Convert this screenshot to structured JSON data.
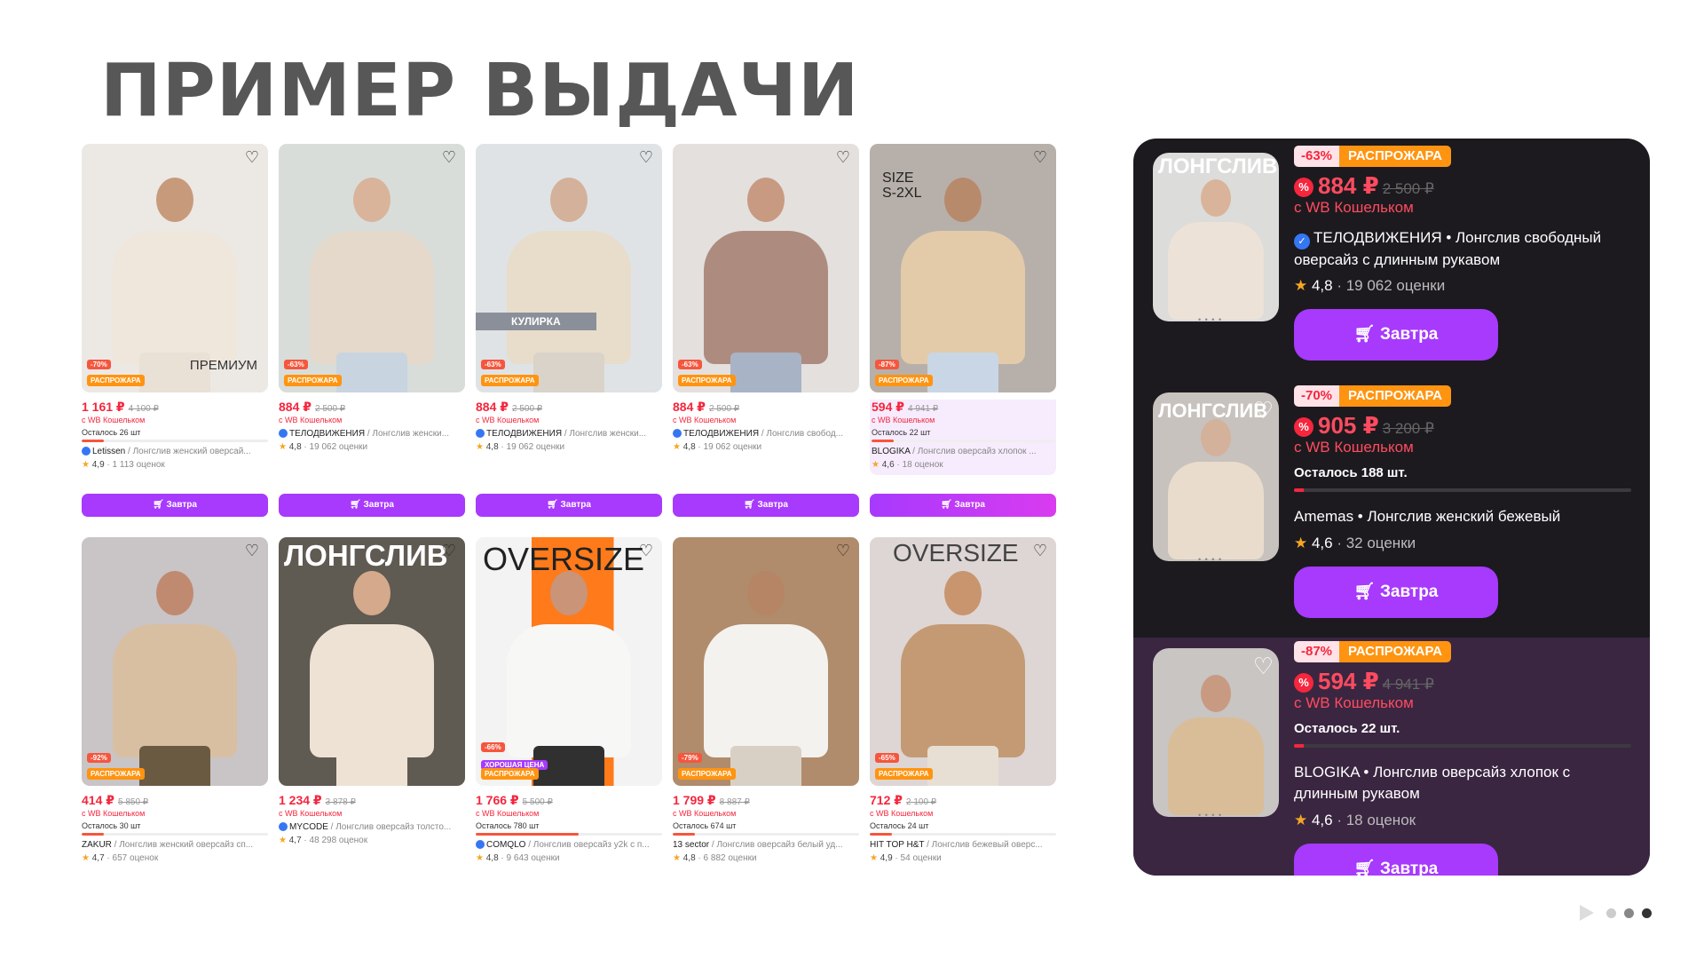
{
  "slide": {
    "title": "ПРИМЕР ВЫДАЧИ"
  },
  "common": {
    "wallet": "с WB Кошельком",
    "sale": "РАСПРОЖАРА",
    "button": "Завтра",
    "good_price": "ХОРОШАЯ ЦЕНА",
    "heart": "♡"
  },
  "grid": [
    {
      "discount": "-70%",
      "price": "1 161 ₽",
      "old": "4 100 ₽",
      "left": "Осталось 26 шт",
      "brand": "Letissen",
      "title": " / Лонгслив женский оверсай...",
      "rating": "4,9",
      "reviews": " · 1 113 оценок",
      "overlay": "ПРЕМИУМ"
    },
    {
      "discount": "-63%",
      "price": "884 ₽",
      "old": "2 500 ₽",
      "left": "",
      "brand": "ТЕЛОДВИЖЕНИЯ",
      "title": " / Лонгслив женски...",
      "rating": "4,8",
      "reviews": " · 19 062 оценки",
      "overlay": ""
    },
    {
      "discount": "-63%",
      "price": "884 ₽",
      "old": "2 500 ₽",
      "left": "",
      "brand": "ТЕЛОДВИЖЕНИЯ",
      "title": " / Лонгслив женски...",
      "rating": "4,8",
      "reviews": " · 19 062 оценки",
      "overlay": "КУЛИРКА"
    },
    {
      "discount": "-63%",
      "price": "884 ₽",
      "old": "2 500 ₽",
      "left": "",
      "brand": "ТЕЛОДВИЖЕНИЯ",
      "title": " / Лонгслив свобод...",
      "rating": "4,8",
      "reviews": " · 19 062 оценки",
      "overlay": ""
    },
    {
      "discount": "-87%",
      "price": "594 ₽",
      "old": "4 941 ₽",
      "left": "Осталось 22 шт",
      "brand": "BLOGIKA",
      "title": " / Лонгслив оверсайз хлопок ...",
      "rating": "4,6",
      "reviews": " · 18 оценок",
      "overlay": "SIZE S-2XL"
    },
    {
      "discount": "-92%",
      "price": "414 ₽",
      "old": "5 850 ₽",
      "left": "Осталось 30 шт",
      "brand": "ZAKUR",
      "title": " / Лонгслив женский оверсайз сп...",
      "rating": "4,7",
      "reviews": " · 657 оценок",
      "overlay": ""
    },
    {
      "discount": "",
      "price": "1 234 ₽",
      "old": "3 878 ₽",
      "left": "",
      "brand": "MYCODE",
      "title": " / Лонгслив оверсайз толсто...",
      "rating": "4,7",
      "reviews": " · 48 298 оценок",
      "overlay": "ЛОНГСЛИВ"
    },
    {
      "discount": "-66%",
      "price": "1 766 ₽",
      "old": "5 500 ₽",
      "left": "Осталось 780 шт",
      "brand": "COMQLO",
      "title": " / Лонгслив оверсайз y2k с п...",
      "rating": "4,8",
      "reviews": " · 9 643 оценки",
      "overlay": "OVERSIZE"
    },
    {
      "discount": "-79%",
      "price": "1 799 ₽",
      "old": "8 887 ₽",
      "left": "Осталось 674 шт",
      "brand": "13 sector",
      "title": " / Лонгслив оверсайз белый уд...",
      "rating": "4,8",
      "reviews": " · 6 882 оценки",
      "overlay": ""
    },
    {
      "discount": "-65%",
      "price": "712 ₽",
      "old": "2 100 ₽",
      "left": "Осталось 24 шт",
      "brand": "HIT TOP H&T",
      "title": " / Лонгслив бежевый оверс...",
      "rating": "4,9",
      "reviews": " · 54 оценки",
      "overlay": "OVERSIZE"
    }
  ],
  "panel": [
    {
      "discount": "-63%",
      "price": "884 ₽",
      "old": "2 500 ₽",
      "left": "",
      "brand": "ТЕЛОДВИЖЕНИЯ",
      "title": " • Лонгслив свободный оверсайз с длинным рукавом",
      "rating": "4,8",
      "reviews": " · 19 062 оценки",
      "overlay": "ЛОНГСЛИВ"
    },
    {
      "discount": "-70%",
      "price": "905 ₽",
      "old": "3 200 ₽",
      "left": "Осталось 188 шт.",
      "brand": "Amemas",
      "title": " • Лонгслив женский бежевый",
      "rating": "4,6",
      "reviews": " · 32 оценки",
      "overlay": "ЛОНГСЛИВ"
    },
    {
      "discount": "-87%",
      "price": "594 ₽",
      "old": "4 941 ₽",
      "left": "Осталось 22 шт.",
      "brand": "BLOGIKA",
      "title": " • Лонгслив оверсайз хлопок с длинным рукавом",
      "rating": "4,6",
      "reviews": " · 18 оценок",
      "overlay": ""
    }
  ],
  "colors": {
    "accent": "#a73afd",
    "price": "#f5263d",
    "sale": "#ff9411",
    "panel_bg": "#1c1a1f",
    "highlight": "#3a2641"
  }
}
